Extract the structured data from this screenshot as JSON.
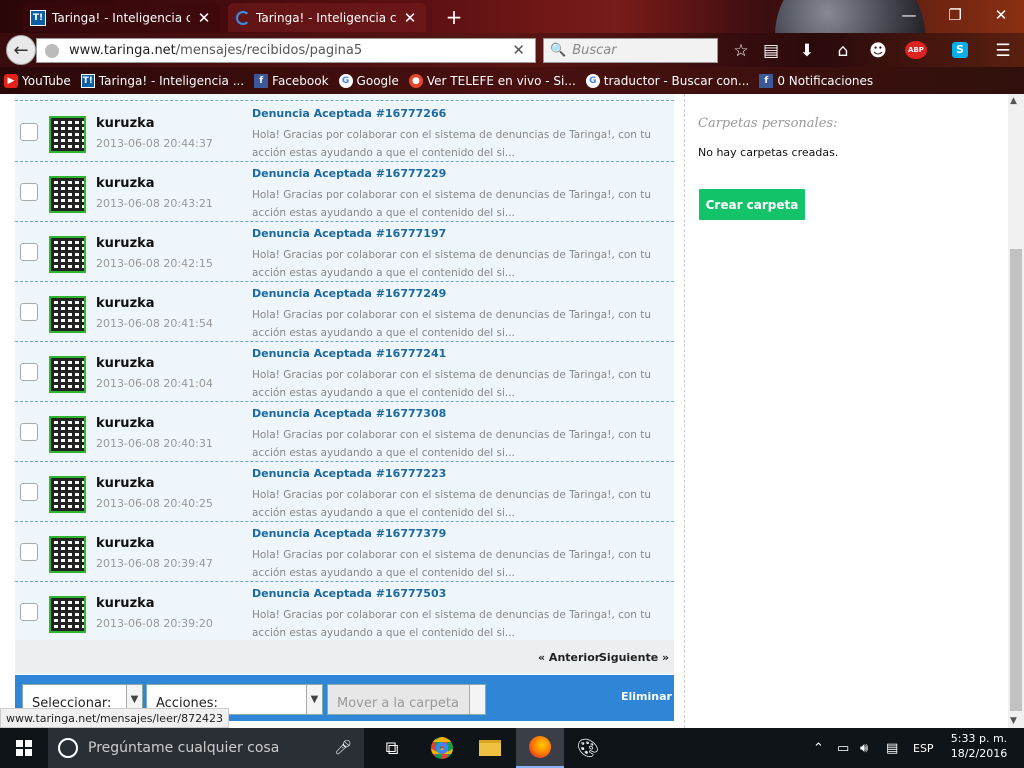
{
  "browser": {
    "tabs": [
      {
        "favicon": "T!",
        "title": "Taringa! - Inteligencia col..."
      },
      {
        "favicon": "spinner",
        "title": "Taringa! - Inteligencia col..."
      }
    ],
    "url_host": "www.taringa.net",
    "url_path": "/mensajes/recibidos/pagina5",
    "search_placeholder": "Buscar",
    "abp_badge": "ABP"
  },
  "bookmarks": [
    {
      "icon": "youtube-icon",
      "label": "YouTube",
      "color": "#e62117"
    },
    {
      "icon": "taringa-icon",
      "label": "Taringa! - Inteligencia ...",
      "color": "#0b5fa5"
    },
    {
      "icon": "facebook-icon",
      "label": "Facebook",
      "color": "#3b5998"
    },
    {
      "icon": "google-icon",
      "label": "Google",
      "color": "#ffffff"
    },
    {
      "icon": "telefe-icon",
      "label": "Ver TELEFE en vivo - Si...",
      "color": "#e5452a"
    },
    {
      "icon": "google-icon",
      "label": "traductor - Buscar con...",
      "color": "#ffffff"
    },
    {
      "icon": "facebook-icon",
      "label": "0 Notificaciones",
      "color": "#3b5998"
    }
  ],
  "messages": [
    {
      "user": "kuruzka",
      "date": "2013-06-08 20:44:37",
      "subject": "Denuncia Aceptada #16777266",
      "preview": "Hola! Gracias por colaborar con el sistema de denuncias de Taringa!, con tu acción estas ayudando a que el contenido del si..."
    },
    {
      "user": "kuruzka",
      "date": "2013-06-08 20:43:21",
      "subject": "Denuncia Aceptada #16777229",
      "preview": "Hola! Gracias por colaborar con el sistema de denuncias de Taringa!, con tu acción estas ayudando a que el contenido del si..."
    },
    {
      "user": "kuruzka",
      "date": "2013-06-08 20:42:15",
      "subject": "Denuncia Aceptada #16777197",
      "preview": "Hola! Gracias por colaborar con el sistema de denuncias de Taringa!, con tu acción estas ayudando a que el contenido del si..."
    },
    {
      "user": "kuruzka",
      "date": "2013-06-08 20:41:54",
      "subject": "Denuncia Aceptada #16777249",
      "preview": "Hola! Gracias por colaborar con el sistema de denuncias de Taringa!, con tu acción estas ayudando a que el contenido del si..."
    },
    {
      "user": "kuruzka",
      "date": "2013-06-08 20:41:04",
      "subject": "Denuncia Aceptada #16777241",
      "preview": "Hola! Gracias por colaborar con el sistema de denuncias de Taringa!, con tu acción estas ayudando a que el contenido del si..."
    },
    {
      "user": "kuruzka",
      "date": "2013-06-08 20:40:31",
      "subject": "Denuncia Aceptada #16777308",
      "preview": "Hola! Gracias por colaborar con el sistema de denuncias de Taringa!, con tu acción estas ayudando a que el contenido del si..."
    },
    {
      "user": "kuruzka",
      "date": "2013-06-08 20:40:25",
      "subject": "Denuncia Aceptada #16777223",
      "preview": "Hola! Gracias por colaborar con el sistema de denuncias de Taringa!, con tu acción estas ayudando a que el contenido del si..."
    },
    {
      "user": "kuruzka",
      "date": "2013-06-08 20:39:47",
      "subject": "Denuncia Aceptada #16777379",
      "preview": "Hola! Gracias por colaborar con el sistema de denuncias de Taringa!, con tu acción estas ayudando a que el contenido del si..."
    },
    {
      "user": "kuruzka",
      "date": "2013-06-08 20:39:20",
      "subject": "Denuncia Aceptada #16777503",
      "preview": "Hola! Gracias por colaborar con el sistema de denuncias de Taringa!, con tu acción estas ayudando a que el contenido del si..."
    }
  ],
  "pagination": {
    "prev": "« Anterior",
    "next": "Siguiente »"
  },
  "actions_bar": {
    "select_label": "Seleccionar:",
    "actions_label": "Acciones:",
    "move_label": "Mover a la carpeta",
    "delete_label": "Eliminar"
  },
  "sidebar": {
    "heading": "Carpetas personales:",
    "empty_text": "No hay carpetas creadas.",
    "create_button": "Crear carpeta"
  },
  "status_url": "www.taringa.net/mensajes/leer/872423",
  "taskbar": {
    "search_placeholder": "Pregúntame cualquier cosa",
    "language": "ESP",
    "time": "5:33 p. m.",
    "date": "18/2/2016"
  },
  "colors": {
    "accent_blue": "#2f86d6",
    "green_button": "#13c36a",
    "link_blue": "#1a6aa0"
  }
}
